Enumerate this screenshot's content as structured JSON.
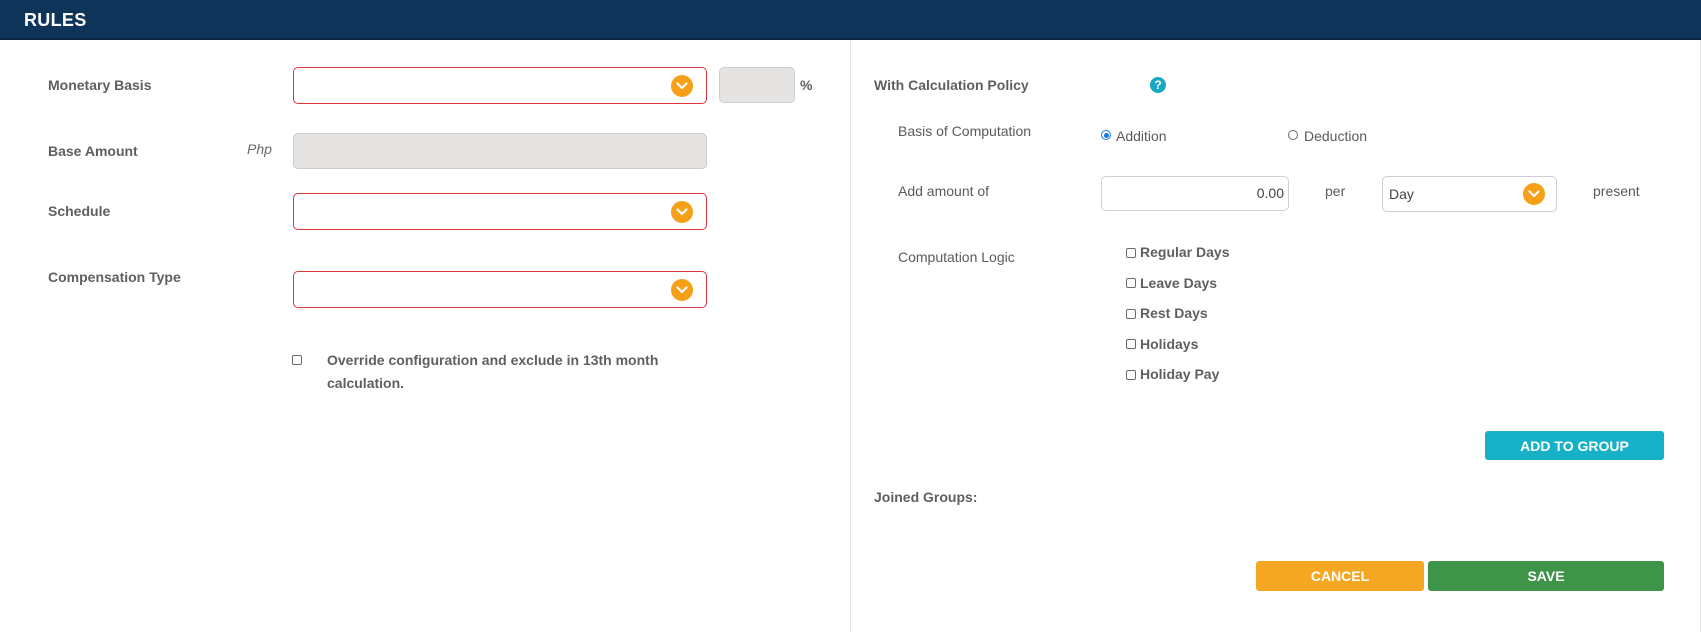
{
  "header": {
    "title": "RULES"
  },
  "left": {
    "monetary_basis": {
      "label": "Monetary Basis",
      "value": "",
      "percent_value": "",
      "percent_symbol": "%"
    },
    "base_amount": {
      "label": "Base Amount",
      "currency": "Php",
      "value": ""
    },
    "schedule": {
      "label": "Schedule",
      "value": ""
    },
    "compensation_type": {
      "label": "Compensation Type",
      "value": ""
    },
    "override": {
      "checked": false,
      "line1": "Override configuration and exclude in 13th month",
      "line2": "calculation."
    }
  },
  "right": {
    "calc_policy": {
      "label": "With Calculation Policy",
      "help_icon": "question-circle-icon",
      "help_glyph": "?"
    },
    "basis": {
      "label": "Basis of Computation",
      "options": [
        {
          "label": "Addition",
          "selected": true
        },
        {
          "label": "Deduction",
          "selected": false
        }
      ]
    },
    "add_amount": {
      "label": "Add amount of",
      "value": "0.00",
      "per_label": "per",
      "unit_value": "Day",
      "suffix": "present"
    },
    "logic": {
      "label": "Computation Logic",
      "items": [
        {
          "label": "Regular Days",
          "checked": false
        },
        {
          "label": "Leave Days",
          "checked": false
        },
        {
          "label": "Rest Days",
          "checked": false
        },
        {
          "label": "Holidays",
          "checked": false
        },
        {
          "label": "Holiday Pay",
          "checked": false
        }
      ]
    },
    "add_to_group_label": "ADD TO GROUP",
    "joined_groups_label": "Joined Groups:",
    "cancel_label": "CANCEL",
    "save_label": "SAVE"
  },
  "colors": {
    "header_bg": "#0f3459",
    "accent_orange": "#f5a017",
    "error_border": "#d9363e",
    "add_button": "#17b1c7",
    "cancel_button": "#f5a623",
    "save_button": "#3e9448"
  }
}
